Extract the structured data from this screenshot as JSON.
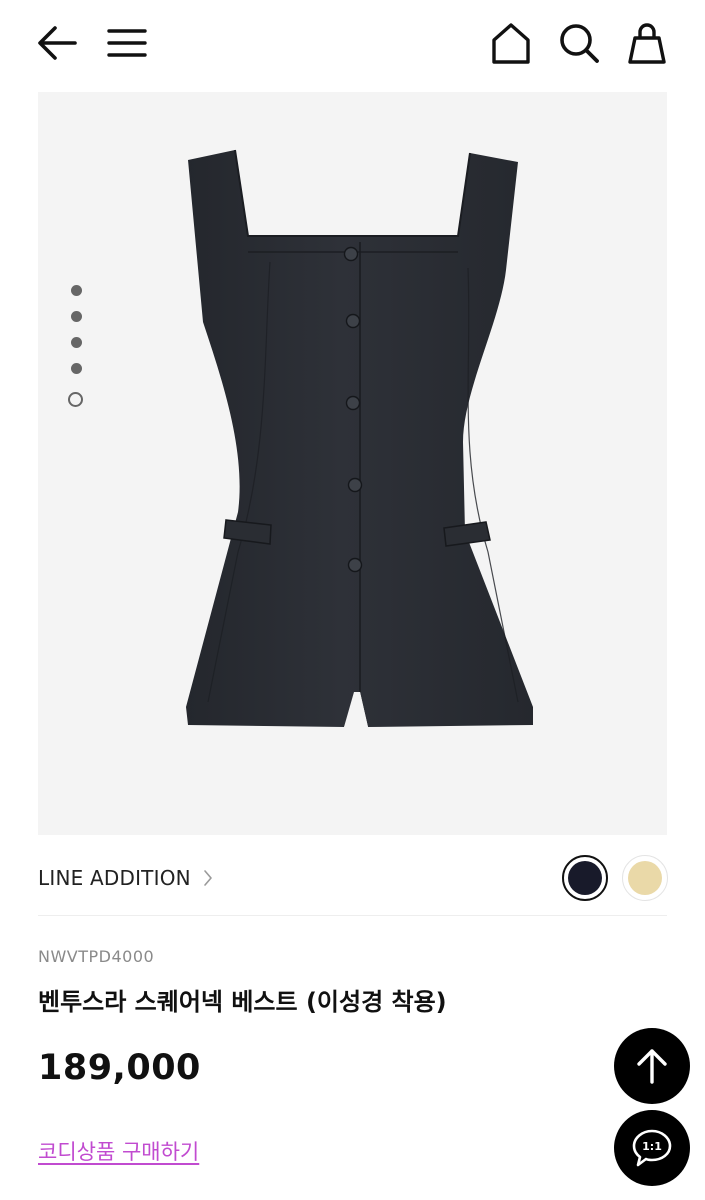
{
  "header": {
    "icons": [
      "arrow-left-icon",
      "hamburger-menu-icon",
      "home-icon",
      "search-icon",
      "shopping-bag-icon"
    ]
  },
  "gallery": {
    "image": "sleeveless-square-neck-vest",
    "image_color": "#2a2d33",
    "dots_total": 5,
    "active_dot": 5
  },
  "brand": {
    "name": "LINE ADDITION",
    "chevron_icon": "chevron-right-icon"
  },
  "color_swatches": [
    {
      "color": "#181a2a",
      "selected": true
    },
    {
      "color": "#ead9a8",
      "selected": false
    }
  ],
  "product": {
    "code": "NWVTPD4000",
    "name": "벤투스라 스퀘어넥 베스트 (이성경 착용)",
    "price": "189,000",
    "coordi_link": "코디상품 구매하기"
  },
  "floating": {
    "scroll_top_icon": "arrow-up-icon",
    "chat_label": "1:1",
    "chat_icon": "chat-bubble-icon"
  },
  "colors": {
    "accent_link": "#c14bd0",
    "fab_bg": "#000000"
  }
}
